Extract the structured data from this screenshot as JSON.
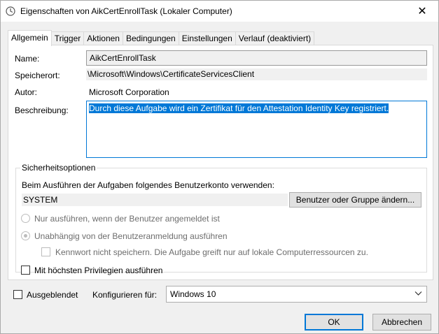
{
  "window": {
    "title": "Eigenschaften von AikCertEnrollTask (Lokaler Computer)",
    "close_glyph": "✕"
  },
  "tabs": [
    {
      "label": "Allgemein",
      "active": true
    },
    {
      "label": "Trigger"
    },
    {
      "label": "Aktionen"
    },
    {
      "label": "Bedingungen"
    },
    {
      "label": "Einstellungen"
    },
    {
      "label": "Verlauf (deaktiviert)"
    }
  ],
  "general": {
    "name_label": "Name:",
    "name_value": "AikCertEnrollTask",
    "location_label": "Speicherort:",
    "location_value": "\\Microsoft\\Windows\\CertificateServicesClient",
    "author_label": "Autor:",
    "author_value": "Microsoft Corporation",
    "description_label": "Beschreibung:",
    "description_value": "Durch diese Aufgabe wird ein Zertifikat für den Attestation Identity Key registriert."
  },
  "security": {
    "title": "Sicherheitsoptionen",
    "account_prompt": "Beim Ausführen der Aufgaben folgendes Benutzerkonto verwenden:",
    "account_value": "SYSTEM",
    "change_user_button": "Benutzer oder Gruppe ändern...",
    "radio_logged_on": "Nur ausführen, wenn der Benutzer angemeldet ist",
    "radio_whether_logged": "Unabhängig von der Benutzeranmeldung ausführen",
    "no_store_password": "Kennwort nicht speichern. Die Aufgabe greift nur auf lokale Computerressourcen zu.",
    "highest_privileges": "Mit höchsten Privilegien ausführen"
  },
  "footer": {
    "hidden_label": "Ausgeblendet",
    "configure_label": "Konfigurieren für:",
    "configure_value": "Windows 10",
    "ok_button": "OK",
    "cancel_button": "Abbrechen"
  }
}
